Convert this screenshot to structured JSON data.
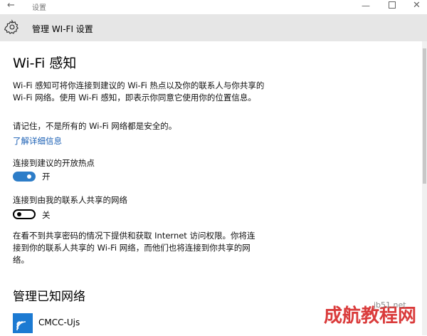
{
  "window": {
    "back_icon": "back-arrow-icon",
    "title": "设置",
    "minimize_icon": "minimize-icon",
    "maximize_icon": "maximize-icon",
    "close_icon": "close-icon"
  },
  "header": {
    "icon": "gear-icon",
    "title": "管理 WI-FI 设置"
  },
  "sense": {
    "heading": "Wi-Fi 感知",
    "description": "Wi-Fi 感知可将你连接到建议的 Wi-Fi 热点以及你的联系人与你共享的 Wi-Fi 网络。使用 Wi-Fi 感知，即表示你同意它使用你的位置信息。",
    "warning": "请记住，不是所有的 Wi-Fi 网络都是安全的。",
    "learn_more": "了解详细信息",
    "open_hotspots": {
      "label": "连接到建议的开放热点",
      "state": "开",
      "on": true
    },
    "contacts_networks": {
      "label": "连接到由我的联系人共享的网络",
      "state": "关",
      "on": false
    },
    "internet_note": "在看不到共享密码的情况下提供和获取 Internet 访问权限。你将连接到你的联系人共享的 Wi-Fi 网络，而他们也将连接到你共享的网络。"
  },
  "known": {
    "heading": "管理已知网络",
    "networks": [
      {
        "name": "CMCC-Ujs",
        "icon": "wifi-icon"
      }
    ]
  },
  "watermark": {
    "text": "成航教程网",
    "site": "jb51.net"
  },
  "colors": {
    "accent": "#2d7dc8",
    "link": "#1a5fb4",
    "header_bg": "#e6e6e6",
    "wifi_tile": "#1c7ad2"
  }
}
